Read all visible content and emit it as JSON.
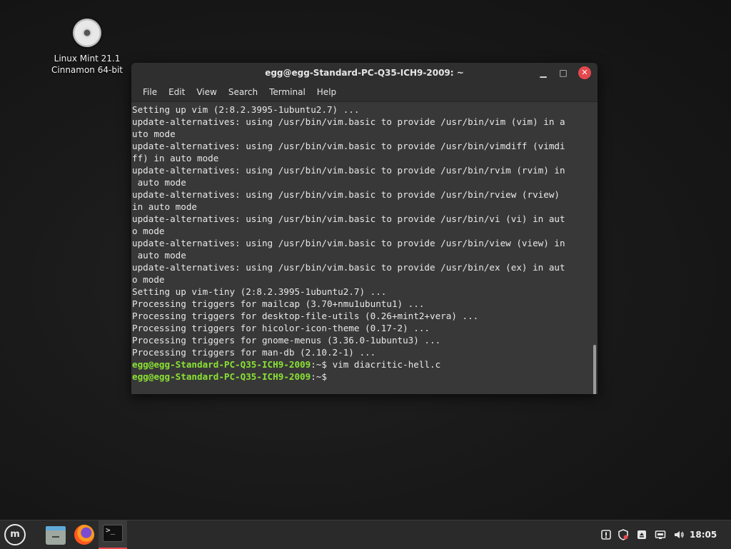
{
  "desktop": {
    "icon_line1": "Linux Mint 21.1",
    "icon_line2": "Cinnamon 64-bit"
  },
  "window": {
    "title": "egg@egg-Standard-PC-Q35-ICH9-2009: ~",
    "minimize": "▁",
    "maximize": "□",
    "close": "✕"
  },
  "menu": {
    "file": "File",
    "edit": "Edit",
    "view": "View",
    "search": "Search",
    "terminal": "Terminal",
    "help": "Help"
  },
  "terminal": {
    "lines": [
      "Setting up vim (2:8.2.3995-1ubuntu2.7) ...",
      "update-alternatives: using /usr/bin/vim.basic to provide /usr/bin/vim (vim) in a",
      "uto mode",
      "update-alternatives: using /usr/bin/vim.basic to provide /usr/bin/vimdiff (vimdi",
      "ff) in auto mode",
      "update-alternatives: using /usr/bin/vim.basic to provide /usr/bin/rvim (rvim) in",
      " auto mode",
      "update-alternatives: using /usr/bin/vim.basic to provide /usr/bin/rview (rview)",
      "in auto mode",
      "update-alternatives: using /usr/bin/vim.basic to provide /usr/bin/vi (vi) in aut",
      "o mode",
      "update-alternatives: using /usr/bin/vim.basic to provide /usr/bin/view (view) in",
      " auto mode",
      "update-alternatives: using /usr/bin/vim.basic to provide /usr/bin/ex (ex) in aut",
      "o mode",
      "Setting up vim-tiny (2:8.2.3995-1ubuntu2.7) ...",
      "Processing triggers for mailcap (3.70+nmu1ubuntu1) ...",
      "Processing triggers for desktop-file-utils (0.26+mint2+vera) ...",
      "Processing triggers for hicolor-icon-theme (0.17-2) ...",
      "Processing triggers for gnome-menus (3.36.0-1ubuntu3) ...",
      "Processing triggers for man-db (2.10.2-1) ..."
    ],
    "prompt_user": "egg@egg-Standard-PC-Q35-ICH9-2009",
    "prompt_suffix": ":~$ ",
    "command1": "vim diacritic-hell.c",
    "command2": ""
  },
  "panel": {
    "menu_glyph": "m",
    "terminal_glyph": ">_",
    "clock": "18:05"
  },
  "colors": {
    "prompt": "#8ae234",
    "close_button": "#e5484d",
    "terminal_bg": "#383838"
  }
}
